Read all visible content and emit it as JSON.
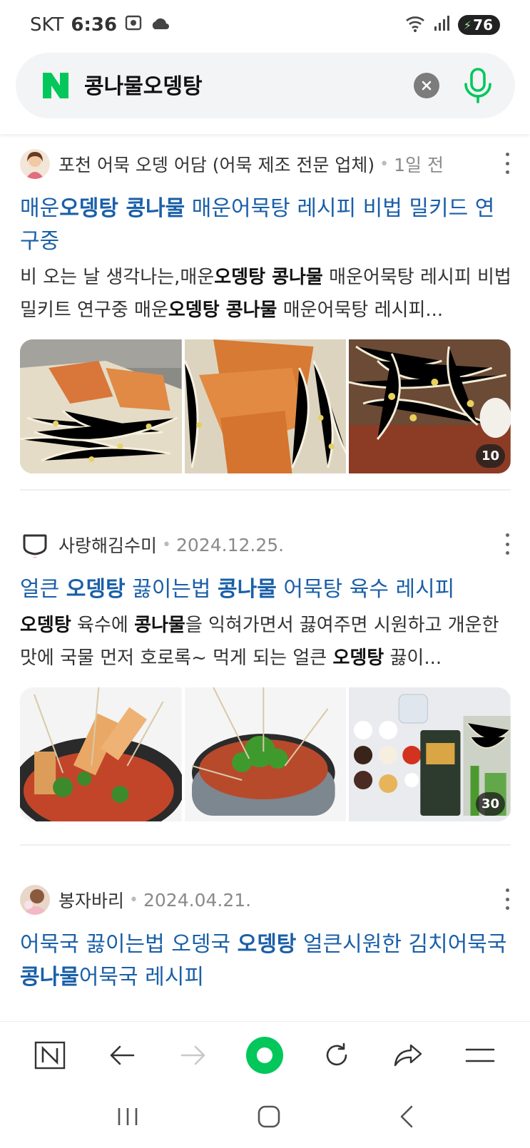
{
  "status_bar": {
    "carrier": "SKT",
    "time": "6:36",
    "battery": "76"
  },
  "search": {
    "query": "콩나물오뎅탕"
  },
  "results": [
    {
      "source": "포천 어묵 오뎅 어담 (어묵 제조 전문 업체)",
      "date": "1일 전",
      "title_parts": [
        "매운",
        "오뎅탕 콩나물",
        " 매운어묵탕 레시피 비법 밀키드 연구중"
      ],
      "desc_parts": [
        "비 오는 날 생각나는,매운",
        "오뎅탕 콩나물",
        " 매운어묵탕 레시피 비법 밀키트 연구중 매운",
        "오뎅탕 콩나물",
        " 매운어묵탕 레시피..."
      ],
      "image_count": "10"
    },
    {
      "source": "사랑해김수미",
      "date": "2024.12.25.",
      "title_parts": [
        "얼큰 ",
        "오뎅탕",
        " 끓이는법 ",
        "콩나물",
        " 어묵탕 육수 레시피"
      ],
      "desc_parts": [
        "오뎅탕",
        " 육수에 ",
        "콩나물",
        "을 익혀가면서 끓여주면 시원하고 개운한 맛에 국물 먼저 호로록~ 먹게 되는 얼큰 ",
        "오뎅탕",
        " 끓이..."
      ],
      "image_count": "30"
    },
    {
      "source": "봉자바리",
      "date": "2024.04.21.",
      "title_parts": [
        "어묵국 끓이는법 오뎅국 ",
        "오뎅탕",
        " 얼큰시원한 김치어묵국 ",
        "콩나물",
        "어묵국 레시피"
      ]
    }
  ],
  "colors": {
    "link": "#1a5fa8",
    "naver_green": "#03c75a"
  }
}
